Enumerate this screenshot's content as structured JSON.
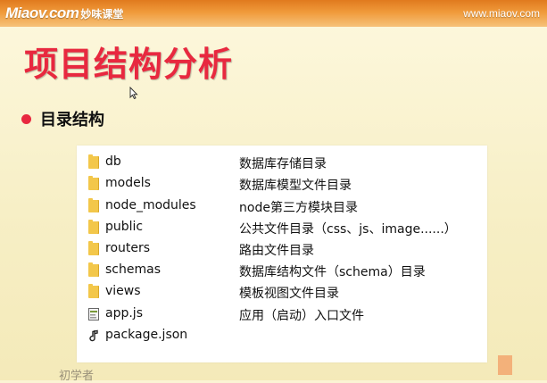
{
  "header": {
    "logo_mark": "Miaov.com",
    "logo_cn": "妙味课堂",
    "site_url": "www.miaov.com"
  },
  "slide": {
    "title": "项目结构分析",
    "bullet": "目录结构"
  },
  "rows": [
    {
      "name": "db",
      "desc": "数据库存储目录",
      "icon": "folder-icon"
    },
    {
      "name": "models",
      "desc": "数据库模型文件目录",
      "icon": "folder-icon"
    },
    {
      "name": "node_modules",
      "desc": "node第三方模块目录",
      "icon": "folder-icon"
    },
    {
      "name": "public",
      "desc": "公共文件目录（css、js、image......）",
      "icon": "folder-icon"
    },
    {
      "name": "routers",
      "desc": "路由文件目录",
      "icon": "folder-icon"
    },
    {
      "name": "schemas",
      "desc": "数据库结构文件（schema）目录",
      "icon": "folder-icon"
    },
    {
      "name": "views",
      "desc": "模板视图文件目录",
      "icon": "folder-icon"
    },
    {
      "name": "app.js",
      "desc": "应用（启动）入口文件",
      "icon": "js-file-icon"
    },
    {
      "name": "package.json",
      "desc": "",
      "icon": "json-file-icon"
    }
  ],
  "watermark": "初学者",
  "colors": {
    "title": "#e8283f",
    "bullet": "#e8283f",
    "folder": "#f3c74a",
    "header": "#f09a3a"
  }
}
